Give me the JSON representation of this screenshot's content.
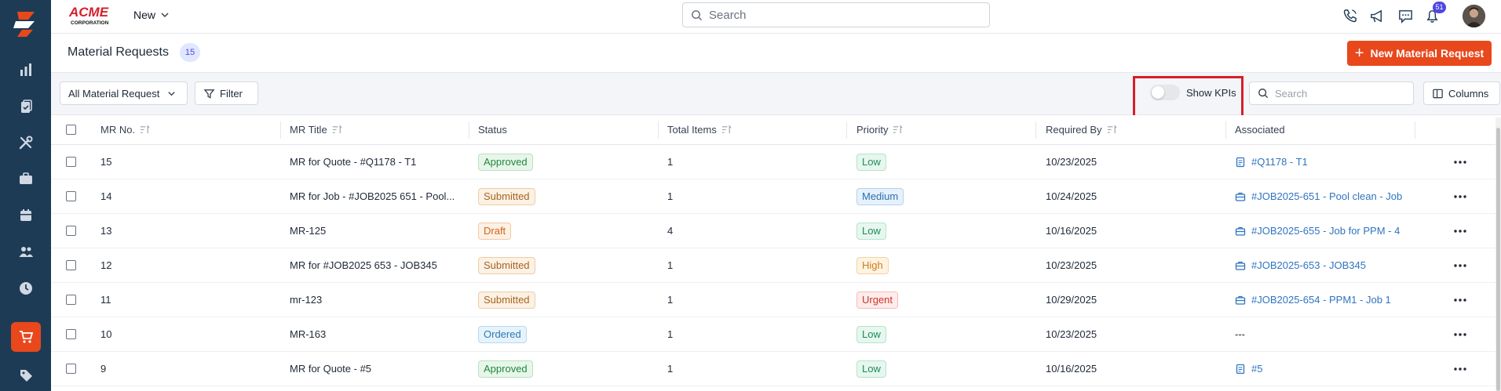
{
  "brand": {
    "name": "ACME",
    "sub": "CORPORATION"
  },
  "topbar": {
    "new_label": "New",
    "search_placeholder": "Search",
    "notification_count": "51"
  },
  "sidebar": {
    "items": [
      "reports",
      "documents",
      "tools",
      "jobs",
      "calendar",
      "customers",
      "time",
      "purchasing",
      "pricing"
    ],
    "active": "purchasing"
  },
  "page": {
    "title": "Material Requests",
    "count": "15",
    "new_button": "New Material Request"
  },
  "toolbar": {
    "view_select": "All Material Request",
    "filter_label": "Filter",
    "show_kpis_label": "Show KPIs",
    "show_kpis_on": false,
    "search_placeholder": "Search",
    "columns_label": "Columns"
  },
  "table": {
    "columns": [
      "MR No.",
      "MR Title",
      "Status",
      "Total Items",
      "Priority",
      "Required By",
      "Associated"
    ],
    "rows": [
      {
        "mr_no": "15",
        "title": "MR for Quote - #Q1178 - T1",
        "status": "Approved",
        "status_class": "st-approved",
        "items": "1",
        "priority": "Low",
        "priority_class": "pr-low",
        "required_by": "10/23/2025",
        "associated": "#Q1178 - T1",
        "assoc_icon": "quote"
      },
      {
        "mr_no": "14",
        "title": "MR for Job - #JOB2025 651 - Pool...",
        "status": "Submitted",
        "status_class": "st-submitted",
        "items": "1",
        "priority": "Medium",
        "priority_class": "pr-medium",
        "required_by": "10/24/2025",
        "associated": "#JOB2025-651 - Pool clean - Job",
        "assoc_icon": "job"
      },
      {
        "mr_no": "13",
        "title": "MR-125",
        "status": "Draft",
        "status_class": "st-draft",
        "items": "4",
        "priority": "Low",
        "priority_class": "pr-low",
        "required_by": "10/16/2025",
        "associated": "#JOB2025-655 - Job for PPM - 4",
        "assoc_icon": "job"
      },
      {
        "mr_no": "12",
        "title": "MR for #JOB2025 653 - JOB345",
        "status": "Submitted",
        "status_class": "st-submitted",
        "items": "1",
        "priority": "High",
        "priority_class": "pr-high",
        "required_by": "10/23/2025",
        "associated": "#JOB2025-653 - JOB345",
        "assoc_icon": "job"
      },
      {
        "mr_no": "11",
        "title": "mr-123",
        "status": "Submitted",
        "status_class": "st-submitted",
        "items": "1",
        "priority": "Urgent",
        "priority_class": "pr-urgent",
        "required_by": "10/29/2025",
        "associated": "#JOB2025-654 - PPM1 - Job 1",
        "assoc_icon": "job"
      },
      {
        "mr_no": "10",
        "title": "MR-163",
        "status": "Ordered",
        "status_class": "st-ordered",
        "items": "1",
        "priority": "Low",
        "priority_class": "pr-low",
        "required_by": "10/23/2025",
        "associated": "---",
        "assoc_icon": "none"
      },
      {
        "mr_no": "9",
        "title": "MR for Quote - #5",
        "status": "Approved",
        "status_class": "st-approved",
        "items": "1",
        "priority": "Low",
        "priority_class": "pr-low",
        "required_by": "10/16/2025",
        "associated": "#5",
        "assoc_icon": "quote"
      }
    ]
  },
  "colors": {
    "accent": "#e8481c",
    "sidebar": "#1e3b55",
    "link": "#2f74c0",
    "highlight": "#d61f2a"
  }
}
